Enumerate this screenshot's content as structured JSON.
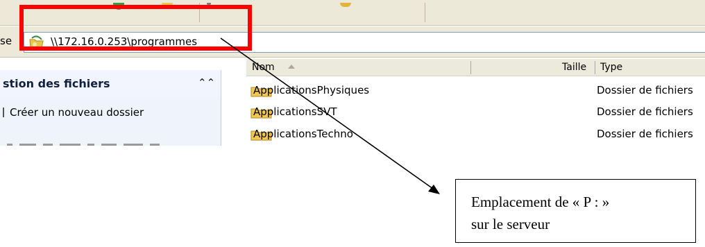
{
  "address_bar": {
    "label": "se",
    "path": "\\\\172.16.0.253\\programmes"
  },
  "task_pane": {
    "section_title": "stion des fichiers",
    "items": [
      "Créer un nouveau dossier"
    ]
  },
  "file_list": {
    "columns": {
      "name": "Nom",
      "size": "Taille",
      "type": "Type"
    },
    "rows": [
      {
        "name": "ApplicationsPhysiques",
        "type": "Dossier de fichiers"
      },
      {
        "name": "ApplicationsSVT",
        "type": "Dossier de fichiers"
      },
      {
        "name": "ApplicationsTechno",
        "type": "Dossier de fichiers"
      }
    ]
  },
  "annotation": {
    "callout_line1": "Emplacement de « P : »",
    "callout_line2": "sur le serveur",
    "highlight_color": "#ff0000"
  }
}
